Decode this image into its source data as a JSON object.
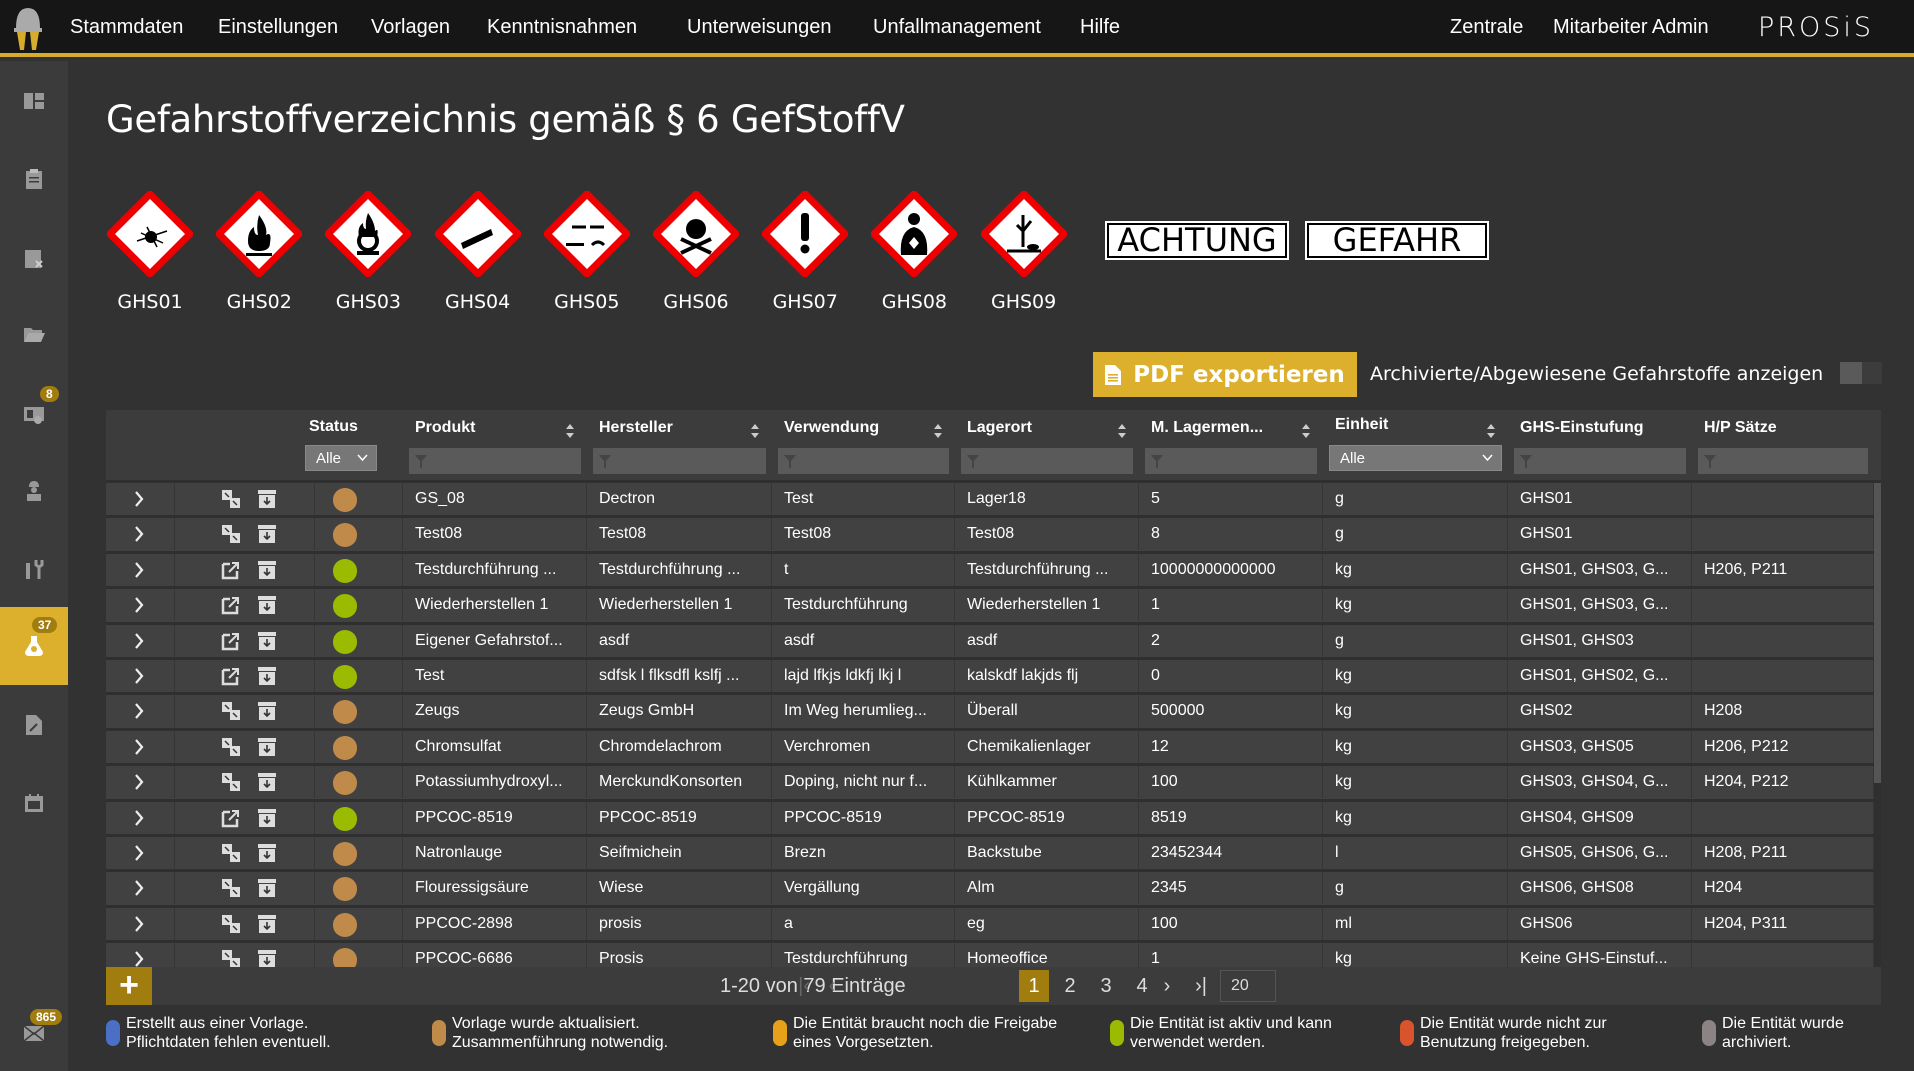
{
  "topbar": {
    "nav": [
      "Stammdaten",
      "Einstellungen",
      "Vorlagen",
      "Kenntnisnahmen",
      "Unterweisungen",
      "Unfallmanagement",
      "Hilfe"
    ],
    "right": [
      "Zentrale",
      "Mitarbeiter Admin"
    ],
    "brand": "PROSiS",
    "accent": "#d6ab2e"
  },
  "sidebar": {
    "items": [
      {
        "icon": "dashboard-icon"
      },
      {
        "icon": "clipboard-icon"
      },
      {
        "icon": "checklist-icon"
      },
      {
        "icon": "folder-icon"
      },
      {
        "icon": "instruction-icon",
        "badge": "8"
      },
      {
        "icon": "worker-icon"
      },
      {
        "icon": "tools-icon"
      },
      {
        "icon": "hazard-flask-icon",
        "badge": "37",
        "active": true
      },
      {
        "icon": "document-edit-icon"
      },
      {
        "icon": "calendar-icon"
      }
    ],
    "mail": {
      "icon": "mail-icon",
      "badge": "865"
    }
  },
  "page": {
    "title": "Gefahrstoffverzeichnis gemäß § 6 GefStoffV"
  },
  "pictograms": [
    "GHS01",
    "GHS02",
    "GHS03",
    "GHS04",
    "GHS05",
    "GHS06",
    "GHS07",
    "GHS08",
    "GHS09"
  ],
  "signal_words": [
    "ACHTUNG",
    "GEFAHR"
  ],
  "toolbar": {
    "pdf_label": "PDF exportieren",
    "archive_label": "Archivierte/Abgewiesene Gefahrstoffe anzeigen",
    "archive_toggle": false
  },
  "table": {
    "headers": {
      "status": "Status",
      "produkt": "Produkt",
      "hersteller": "Hersteller",
      "verwendung": "Verwendung",
      "lagerort": "Lagerort",
      "menge": "M. Lagermen...",
      "einheit": "Einheit",
      "ghs": "GHS-Einstufung",
      "hp": "H/P Sätze"
    },
    "status_filter": "Alle",
    "einheit_filter": "Alle",
    "rows": [
      {
        "action": "merge",
        "status": "template-updated",
        "produkt": "GS_08",
        "hersteller": "Dectron",
        "verwendung": "Test",
        "lagerort": "Lager18",
        "menge": "5",
        "einheit": "g",
        "ghs": "GHS01",
        "hp": ""
      },
      {
        "action": "merge",
        "status": "template-updated",
        "produkt": "Test08",
        "hersteller": "Test08",
        "verwendung": "Test08",
        "lagerort": "Test08",
        "menge": "8",
        "einheit": "g",
        "ghs": "GHS01",
        "hp": ""
      },
      {
        "action": "open",
        "status": "active",
        "produkt": "Testdurchführung ...",
        "hersteller": "Testdurchführung ...",
        "verwendung": "t",
        "lagerort": "Testdurchführung ...",
        "menge": "10000000000000",
        "einheit": "kg",
        "ghs": "GHS01, GHS03, G...",
        "hp": "H206, P211"
      },
      {
        "action": "open",
        "status": "active",
        "produkt": "Wiederherstellen 1",
        "hersteller": "Wiederherstellen 1",
        "verwendung": "Testdurchführung",
        "lagerort": "Wiederherstellen 1",
        "menge": "1",
        "einheit": "kg",
        "ghs": "GHS01, GHS03, G...",
        "hp": ""
      },
      {
        "action": "open",
        "status": "active",
        "produkt": "Eigener Gefahrstof...",
        "hersteller": "asdf",
        "verwendung": "asdf",
        "lagerort": "asdf",
        "menge": "2",
        "einheit": "g",
        "ghs": "GHS01, GHS03",
        "hp": ""
      },
      {
        "action": "open",
        "status": "active",
        "produkt": "Test",
        "hersteller": "sdfsk l flksdfl kslfj ...",
        "verwendung": "lajd lfkjs ldkfj lkj l",
        "lagerort": "kalskdf lakjds flj",
        "menge": "0",
        "einheit": "kg",
        "ghs": "GHS01, GHS02, G...",
        "hp": ""
      },
      {
        "action": "merge",
        "status": "template-updated",
        "produkt": "Zeugs",
        "hersteller": "Zeugs GmbH",
        "verwendung": "Im Weg herumlieg...",
        "lagerort": "Überall",
        "menge": "500000",
        "einheit": "kg",
        "ghs": "GHS02",
        "hp": "H208"
      },
      {
        "action": "merge",
        "status": "template-updated",
        "produkt": "Chromsulfat",
        "hersteller": "Chromdelachrom",
        "verwendung": "Verchromen",
        "lagerort": "Chemikalienlager",
        "menge": "12",
        "einheit": "kg",
        "ghs": "GHS03, GHS05",
        "hp": "H206, P212"
      },
      {
        "action": "merge",
        "status": "template-updated",
        "produkt": "Potassiumhydroxyl...",
        "hersteller": "MerckundKonsorten",
        "verwendung": "Doping, nicht nur f...",
        "lagerort": "Kühlkammer",
        "menge": "100",
        "einheit": "kg",
        "ghs": "GHS03, GHS04, G...",
        "hp": "H204, P212"
      },
      {
        "action": "open",
        "status": "active",
        "produkt": "PPCOC-8519",
        "hersteller": "PPCOC-8519",
        "verwendung": "PPCOC-8519",
        "lagerort": "PPCOC-8519",
        "menge": "8519",
        "einheit": "kg",
        "ghs": "GHS04, GHS09",
        "hp": ""
      },
      {
        "action": "merge",
        "status": "template-updated",
        "produkt": "Natronlauge",
        "hersteller": "Seifmichein",
        "verwendung": "Brezn",
        "lagerort": "Backstube",
        "menge": "23452344",
        "einheit": "l",
        "ghs": "GHS05, GHS06, G...",
        "hp": "H208, P211"
      },
      {
        "action": "merge",
        "status": "template-updated",
        "produkt": "Flouressigsäure",
        "hersteller": "Wiese",
        "verwendung": "Vergällung",
        "lagerort": "Alm",
        "menge": "2345",
        "einheit": "g",
        "ghs": "GHS06, GHS08",
        "hp": "H204"
      },
      {
        "action": "merge",
        "status": "template-updated",
        "produkt": "PPCOC-2898",
        "hersteller": "prosis",
        "verwendung": "a",
        "lagerort": "eg",
        "menge": "100",
        "einheit": "ml",
        "ghs": "GHS06",
        "hp": "H204, P311"
      },
      {
        "action": "merge",
        "status": "template-updated",
        "produkt": "PPCOC-6686",
        "hersteller": "Prosis",
        "verwendung": "Testdurchführung",
        "lagerort": "Homeoffice",
        "menge": "1",
        "einheit": "kg",
        "ghs": "Keine GHS-Einstuf...",
        "hp": ""
      }
    ]
  },
  "pager": {
    "summary": "1-20 von 79 Einträge",
    "pages": [
      "1",
      "2",
      "3",
      "4"
    ],
    "current": "1",
    "page_size": "20",
    "add_label": "+"
  },
  "status_colors": {
    "template-created": "#4a6fc4",
    "template-updated": "#c08a4a",
    "needs-approval": "#e8a21a",
    "active": "#9bbb00",
    "rejected": "#d9532c",
    "archived": "#8c8484"
  },
  "legend": [
    {
      "status": "template-created",
      "line1": "Erstellt aus einer Vorlage.",
      "line2": "Pflichtdaten fehlen eventuell."
    },
    {
      "status": "template-updated",
      "line1": "Vorlage wurde aktualisiert.",
      "line2": "Zusammenführung notwendig."
    },
    {
      "status": "needs-approval",
      "line1": "Die Entität braucht noch die Freigabe",
      "line2": "eines Vorgesetzten."
    },
    {
      "status": "active",
      "line1": "Die Entität ist aktiv und kann",
      "line2": "verwendet werden."
    },
    {
      "status": "rejected",
      "line1": "Die Entität wurde nicht zur",
      "line2": "Benutzung freigegeben."
    },
    {
      "status": "archived",
      "line1": "Die Entität wurde",
      "line2": "archiviert."
    }
  ]
}
